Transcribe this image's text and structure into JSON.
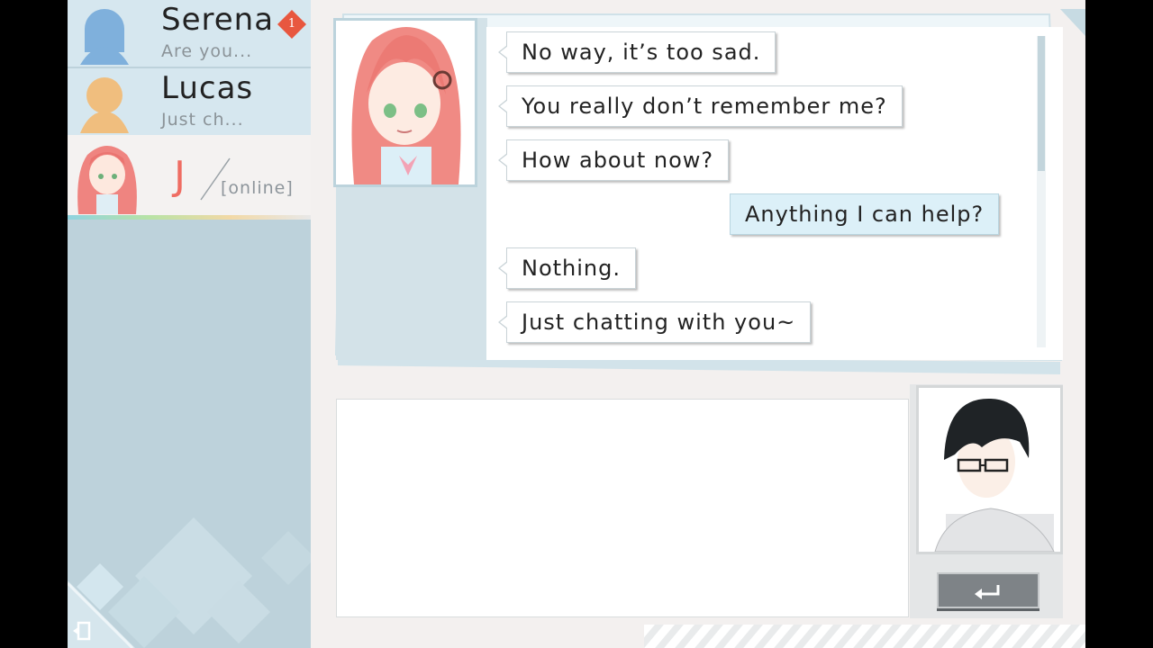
{
  "contacts": [
    {
      "name": "Serena",
      "preview": "Are you...",
      "badge": "1"
    },
    {
      "name": "Lucas",
      "preview": "Just ch..."
    }
  ],
  "active_contact": {
    "initial": "J",
    "status": "[online]"
  },
  "messages": [
    {
      "text": "No way, it’s too sad.",
      "direction": "in"
    },
    {
      "text": "You really don’t remember me?",
      "direction": "in"
    },
    {
      "text": "How about now?",
      "direction": "in"
    },
    {
      "text": "Anything I can help?",
      "direction": "out"
    },
    {
      "text": "Nothing.",
      "direction": "in"
    },
    {
      "text": "Just chatting with you~",
      "direction": "in"
    }
  ],
  "colors": {
    "accent": "#ef6d63",
    "outgoing_bubble": "#dcf0f8",
    "sidebar": "#bdd2db"
  },
  "icons": {
    "exit": "exit-icon",
    "send": "enter-return-icon"
  }
}
